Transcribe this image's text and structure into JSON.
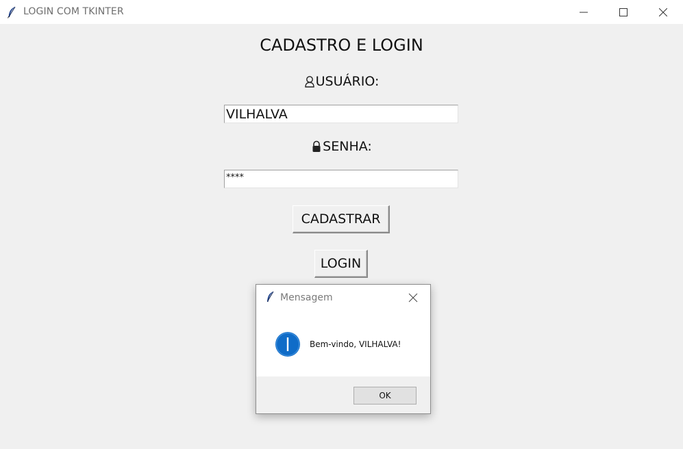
{
  "window": {
    "title": "LOGIN COM TKINTER",
    "app_icon": "feather-icon",
    "controls": {
      "minimize": "minimize-icon",
      "maximize": "maximize-icon",
      "close": "close-icon"
    }
  },
  "form": {
    "heading": "CADASTRO E LOGIN",
    "user_label": "USUÁRIO:",
    "user_icon": "user-icon",
    "user_value": "VILHALVA",
    "password_label": "SENHA:",
    "password_icon": "lock-icon",
    "password_value": "****",
    "register_button": "CADASTRAR",
    "login_button": "LOGIN"
  },
  "dialog": {
    "title": "Mensagem",
    "icon": "info-icon",
    "message": "Bem-vindo, VILHALVA!",
    "ok_button": "OK"
  },
  "colors": {
    "background": "#f0f0f0",
    "info_blue": "#0f6cc8"
  }
}
